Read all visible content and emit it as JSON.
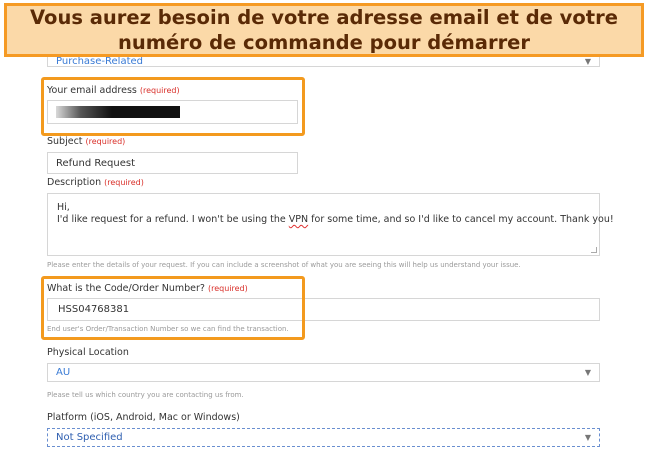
{
  "banner": {
    "text": "Vous aurez besoin de votre adresse email et de votre\nnuméro de commande pour démarrer"
  },
  "form": {
    "category": {
      "value": "Purchase-Related"
    },
    "email": {
      "label": "Your email address",
      "required": "(required)"
    },
    "subject": {
      "label": "Subject",
      "required": "(required)",
      "value": "Refund Request"
    },
    "description": {
      "label": "Description",
      "required": "(required)",
      "line1": "Hi,",
      "line2_before": "I'd like request for a refund. I won't be using the ",
      "line2_error": "VPN",
      "line2_after": " for some time, and so I'd like to cancel my account. Thank you!",
      "help": "Please enter the details of your request. If you can include a screenshot of what you are seeing this will help us understand your issue."
    },
    "order": {
      "label": "What is the Code/Order Number?",
      "required": "(required)",
      "value": "HSS04768381",
      "help": "End user's Order/Transaction Number so we can find the transaction."
    },
    "location": {
      "label": "Physical Location",
      "value": "AU",
      "help": "Please tell us which country you are contacting us from."
    },
    "platform": {
      "label": "Platform (iOS, Android, Mac or Windows)",
      "value": "Not Specified"
    }
  },
  "icons": {
    "dropdown": "chevron-down-icon"
  },
  "colors": {
    "highlight": "#f39a1e",
    "banner_bg": "#fbd9a8",
    "required": "#d9302a",
    "link": "#3a7bd5"
  }
}
